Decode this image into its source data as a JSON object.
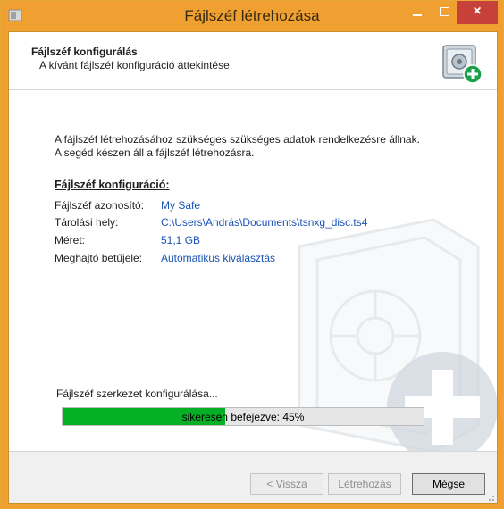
{
  "window": {
    "title": "Fájlszéf létrehozása",
    "close_glyph": "×"
  },
  "header": {
    "title": "Fájlszéf konfigurálás",
    "subtitle": "A kívánt fájlszéf konfiguráció áttekintése",
    "icon": "safe-add-icon"
  },
  "intro": {
    "line1": "A fájlszéf létrehozásához szükséges szükséges adatok rendelkezésre állnak.",
    "line2": "A segéd készen áll a fájlszéf létrehozásra."
  },
  "config": {
    "section_title": "Fájlszéf konfiguráció:",
    "rows": [
      {
        "label": "Fájlszéf azonosító:",
        "value": "My Safe"
      },
      {
        "label": "Tárolási hely:",
        "value": "C:\\Users\\András\\Documents\\tsnxg_disc.ts4"
      },
      {
        "label": "Méret:",
        "value": "51,1 GB"
      },
      {
        "label": "Meghajtó betűjele:",
        "value": "Automatikus kiválasztás"
      }
    ]
  },
  "progress": {
    "label": "Fájlszéf szerkezet konfigurálása...",
    "text": "sikeresen befejezve: 45%",
    "fraction": 0.45
  },
  "buttons": {
    "back": "< Vissza",
    "create": "Létrehozás",
    "cancel": "Mégse"
  },
  "colors": {
    "titlebar": "#f0a030",
    "close": "#c7403a",
    "progress_fill": "#06b025",
    "link_value": "#1a52b5"
  }
}
